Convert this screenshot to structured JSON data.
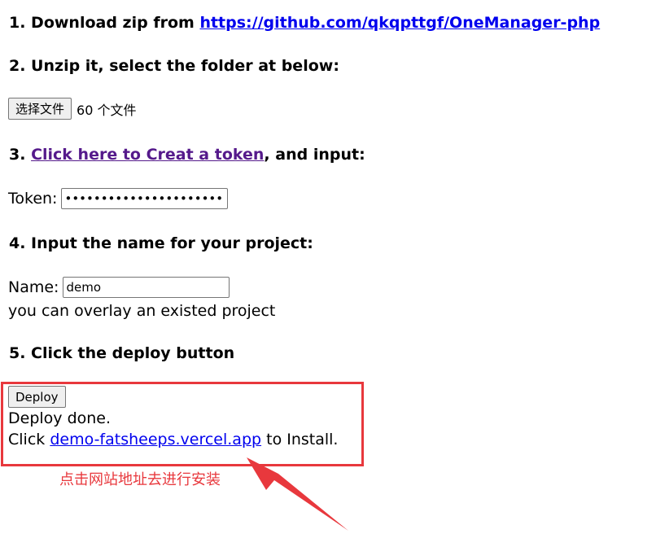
{
  "steps": {
    "s1": {
      "text": "1. Download zip from ",
      "link": "https://github.com/qkqpttgf/OneManager-php"
    },
    "s2": {
      "text": "2. Unzip it, select the folder at below:"
    },
    "s3": {
      "prefix": "3. ",
      "link": "Click here to Creat a token",
      "suffix": ", and input:"
    },
    "s4": {
      "text": "4. Input the name for your project:"
    },
    "s5": {
      "text": "5. Click the deploy button"
    }
  },
  "file_picker": {
    "button_label": "选择文件",
    "status": "60 个文件"
  },
  "token": {
    "label": "Token:",
    "value": "•••••••••••••••••••••••"
  },
  "name": {
    "label": "Name:",
    "value": "demo",
    "hint": "you can overlay an existed project"
  },
  "deploy": {
    "button_label": "Deploy",
    "status": "Deploy done.",
    "click_prefix": "Click ",
    "site_link": "demo-fatsheeps.vercel.app",
    "click_suffix": " to Install."
  },
  "annotation": {
    "text": "点击网站地址去进行安装",
    "color": "#e8383d"
  }
}
